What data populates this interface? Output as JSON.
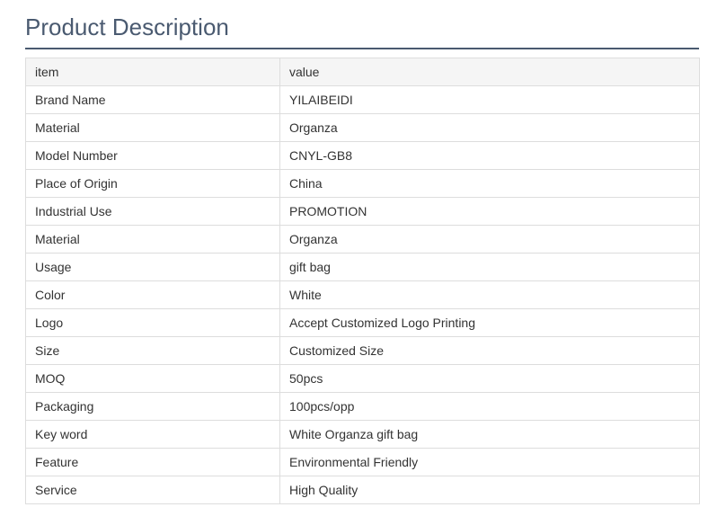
{
  "title": "Product Description",
  "table": {
    "header": {
      "item": "item",
      "value": "value"
    },
    "rows": [
      {
        "item": "Brand Name",
        "value": "YILAIBEIDI"
      },
      {
        "item": "Material",
        "value": "Organza"
      },
      {
        "item": "Model Number",
        "value": "CNYL-GB8"
      },
      {
        "item": "Place of Origin",
        "value": "China"
      },
      {
        "item": "Industrial Use",
        "value": "PROMOTION"
      },
      {
        "item": "Material",
        "value": "Organza"
      },
      {
        "item": "Usage",
        "value": "gift bag"
      },
      {
        "item": "Color",
        "value": "White"
      },
      {
        "item": "Logo",
        "value": "Accept Customized Logo Printing"
      },
      {
        "item": "Size",
        "value": "Customized Size"
      },
      {
        "item": "MOQ",
        "value": "50pcs"
      },
      {
        "item": "Packaging",
        "value": "100pcs/opp"
      },
      {
        "item": "Key word",
        "value": "White Organza gift bag"
      },
      {
        "item": "Feature",
        "value": "Environmental Friendly"
      },
      {
        "item": "Service",
        "value": "High Quality"
      }
    ]
  }
}
